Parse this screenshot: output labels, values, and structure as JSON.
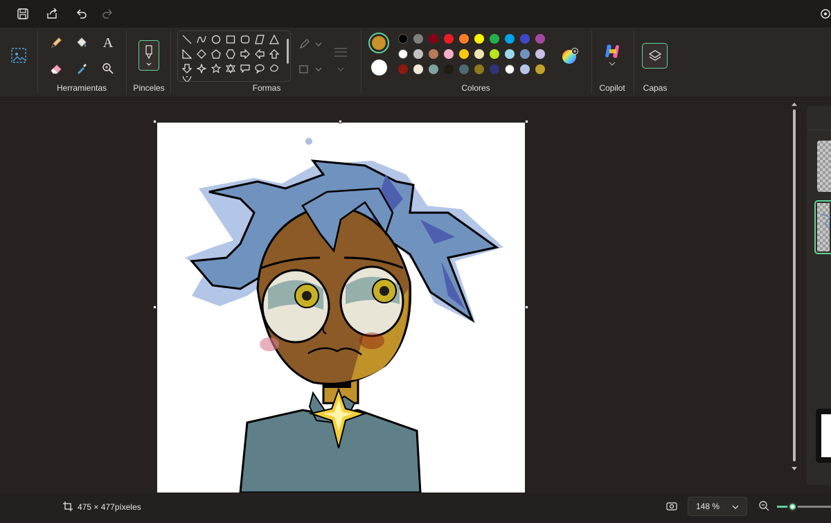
{
  "titlebar": {
    "icons": [
      "save-icon",
      "share-icon",
      "undo-icon",
      "redo-icon",
      "settings-icon"
    ]
  },
  "ribbon": {
    "groups": {
      "tools": "Herramientas",
      "brushes": "Pinceles",
      "shapes": "Formas",
      "colors": "Colores",
      "copilot": "Copilot",
      "layers": "Capas"
    },
    "text_tool_glyph": "A",
    "primary_color": "#c8922a",
    "secondary_color": "#ffffff",
    "palette": [
      [
        "#000000",
        "#7f7f7f",
        "#880015",
        "#ed1c24",
        "#ff7f27",
        "#fff200",
        "#22b14c",
        "#00a2e8",
        "#3f48cc",
        "#a349a4"
      ],
      [
        "#ffffff",
        "#c3c3c3",
        "#b97a57",
        "#ffaec9",
        "#ffc90e",
        "#efe4b0",
        "#b5e61d",
        "#99d9ea",
        "#7092be",
        "#c8bfe7"
      ],
      [
        "#8b1a10",
        "#efe8d6",
        "#7fa3a0",
        "#1e1c14",
        "#4e6a72",
        "#8a7a1a",
        "#2f3578",
        "#ffffff",
        "#b4c6e7",
        "#c0a228"
      ]
    ]
  },
  "status": {
    "dimensions": "475 × 477píxeles",
    "zoom": "148 %"
  }
}
